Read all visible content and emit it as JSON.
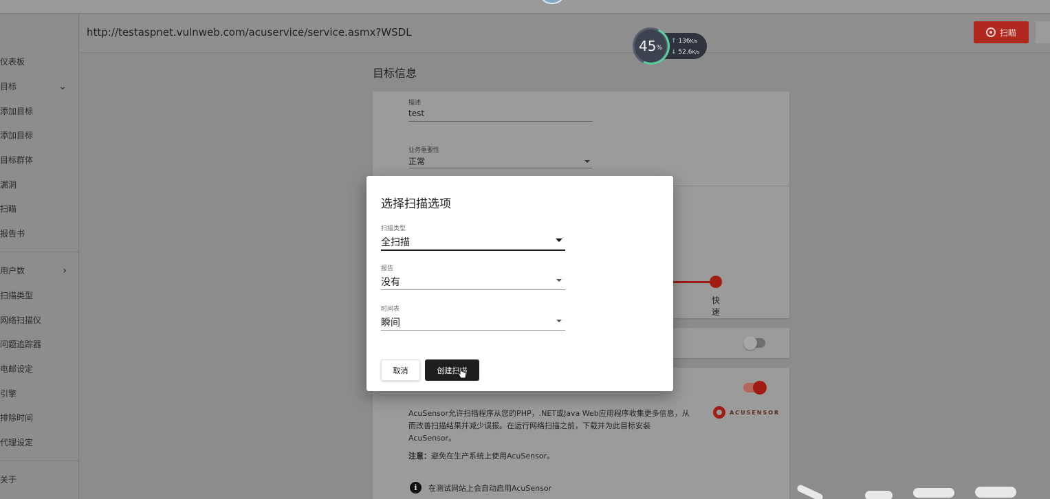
{
  "sidebar": {
    "items": [
      {
        "label": "仪表板",
        "chevron": ""
      },
      {
        "label": "目标",
        "chevron": "⌄"
      },
      {
        "label": "添加目标",
        "chevron": ""
      },
      {
        "label": "添加目标",
        "chevron": ""
      },
      {
        "label": "目标群体",
        "chevron": ""
      },
      {
        "label": "漏洞",
        "chevron": ""
      },
      {
        "label": "扫瞄",
        "chevron": ""
      },
      {
        "label": "报告书",
        "chevron": ""
      },
      {
        "label": "用户数",
        "chevron": "›"
      },
      {
        "label": "扫描类型",
        "chevron": ""
      },
      {
        "label": "网络扫描仪",
        "chevron": ""
      },
      {
        "label": "问题追踪器",
        "chevron": ""
      },
      {
        "label": "电邮设定",
        "chevron": ""
      },
      {
        "label": "引擎",
        "chevron": ""
      },
      {
        "label": "排除时间",
        "chevron": ""
      },
      {
        "label": "代理设定",
        "chevron": ""
      },
      {
        "label": "关于",
        "chevron": ""
      }
    ]
  },
  "header": {
    "url": "http://testaspnet.vulnweb.com/acuservice/service.asmx?WSDL",
    "scan_button": "扫瞄"
  },
  "network": {
    "percent": "45",
    "percent_unit": "%",
    "upload": "136",
    "download": "52.6",
    "unit": "K/s",
    "arrow_up": "↑",
    "arrow_down": "↓"
  },
  "target_info": {
    "title": "目标信息",
    "description_label": "描述",
    "description_value": "test",
    "criticality_label": "业务重要性",
    "criticality_value": "正常",
    "speed_label": "快速"
  },
  "acusensor": {
    "description": "AcuSensor允许扫描程序从您的PHP，.NET或Java Web应用程序收集更多信息，从而改善扫描结果并减少误报。在运行网络扫描之前，下载并为此目标安装AcuSensor。",
    "note_prefix": "注意：",
    "note_text": "避免在生产系统上使用AcuSensor。",
    "logo_text": "ACUSENSOR",
    "info_text": "在测试网站上会自动启用AcuSensor",
    "info_glyph": "i"
  },
  "modal": {
    "title": "选择扫描选项",
    "scan_type_label": "扫描类型",
    "scan_type_value": "全扫描",
    "report_label": "报告",
    "report_value": "没有",
    "schedule_label": "时间表",
    "schedule_value": "瞬间",
    "cancel_label": "取消",
    "create_label": "创建扫描"
  },
  "icons": {
    "scan": "scan-radar-icon",
    "info": "info-icon",
    "dropdown": "dropdown-caret-icon",
    "cursor": "hand-pointer-icon"
  },
  "colors": {
    "accent_red": "#a11c14",
    "scan_button": "#b2271e",
    "primary_button": "#1e1e1e"
  }
}
